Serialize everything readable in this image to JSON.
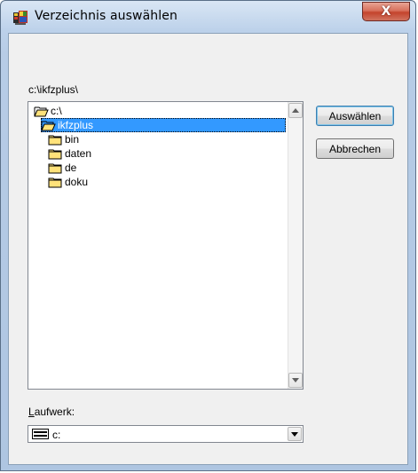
{
  "window": {
    "title": "Verzeichnis auswählen",
    "close_label": "X"
  },
  "path_label": "c:\\ikfzplus\\",
  "directory_list": {
    "items": [
      {
        "label": "c:\\",
        "icon": "open-folder-icon",
        "selected": false
      },
      {
        "label": "ikfzplus",
        "icon": "open-folder-icon",
        "selected": true
      },
      {
        "label": "bin",
        "icon": "folder-icon",
        "selected": false
      },
      {
        "label": "daten",
        "icon": "folder-icon",
        "selected": false
      },
      {
        "label": "de",
        "icon": "folder-icon",
        "selected": false
      },
      {
        "label": "doku",
        "icon": "folder-icon",
        "selected": false
      }
    ]
  },
  "buttons": {
    "select_label": "Auswählen",
    "cancel_label": "Abbrechen"
  },
  "drive": {
    "label_underlined": "L",
    "label_rest": "aufwerk:",
    "selected_value": "c:"
  },
  "colors": {
    "selection": "#3399ff",
    "client_bg": "#f0f0f0",
    "close_button": "#c4432c"
  }
}
